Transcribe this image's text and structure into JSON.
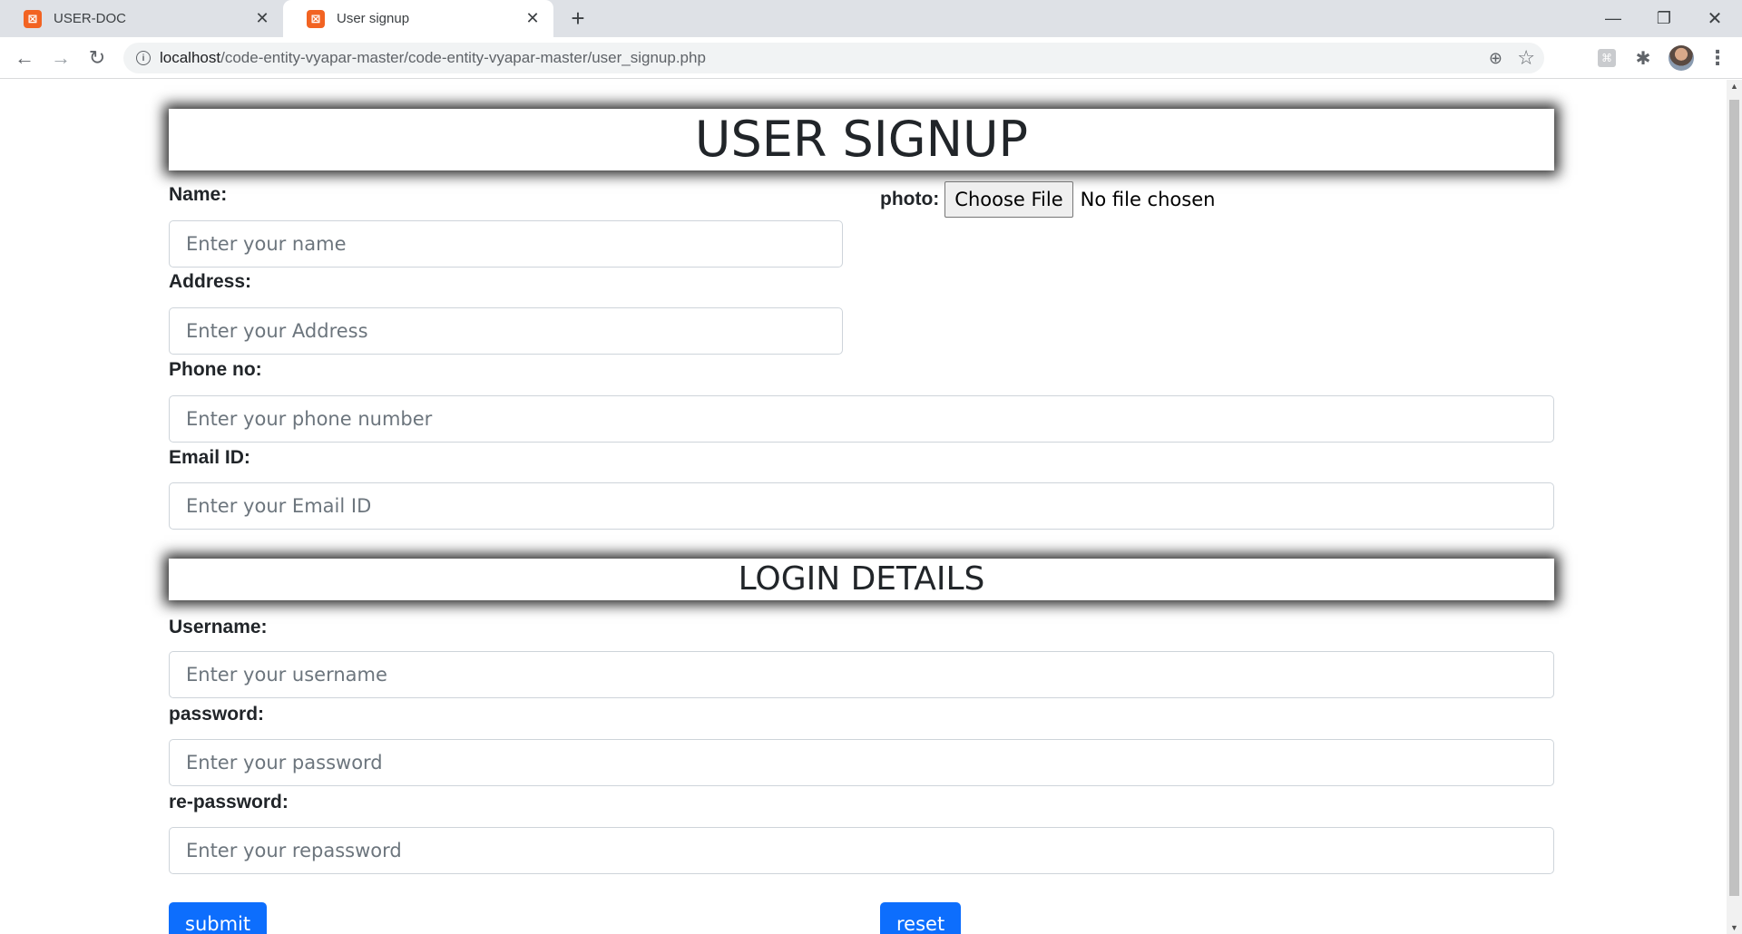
{
  "browser": {
    "tabs": [
      {
        "title": "USER-DOC",
        "active": false
      },
      {
        "title": "User signup",
        "active": true
      }
    ],
    "url_host": "localhost",
    "url_path": "/code-entity-vyapar-master/code-entity-vyapar-master/user_signup.php",
    "icons": {
      "favicon": "xampp-icon",
      "back": "arrow-left-icon",
      "forward": "arrow-right-icon",
      "reload": "reload-icon",
      "info": "info-icon",
      "zoom": "zoom-icon",
      "bookmark": "star-icon",
      "extension": "extension-icon",
      "extensions_menu": "puzzle-icon",
      "profile": "avatar",
      "menu": "kebab-menu-icon"
    }
  },
  "page": {
    "heading": "USER SIGNUP",
    "login_heading": "LOGIN DETAILS",
    "name": {
      "label": "Name:",
      "placeholder": "Enter your name"
    },
    "address": {
      "label": "Address:",
      "placeholder": "Enter your Address"
    },
    "phone": {
      "label": "Phone no:",
      "placeholder": "Enter your phone number"
    },
    "email": {
      "label": "Email ID:",
      "placeholder": "Enter your Email ID"
    },
    "photo": {
      "label": "photo:",
      "button": "Choose File",
      "status": "No file chosen"
    },
    "username": {
      "label": "Username:",
      "placeholder": "Enter your username"
    },
    "password": {
      "label": "password:",
      "placeholder": "Enter your password"
    },
    "repassword": {
      "label": "re-password:",
      "placeholder": "Enter your repassword"
    },
    "submit_label": "submit",
    "reset_label": "reset"
  },
  "colors": {
    "primary_button": "#0d6efd",
    "tab_strip": "#dee1e6",
    "favicon": "#f26322"
  }
}
